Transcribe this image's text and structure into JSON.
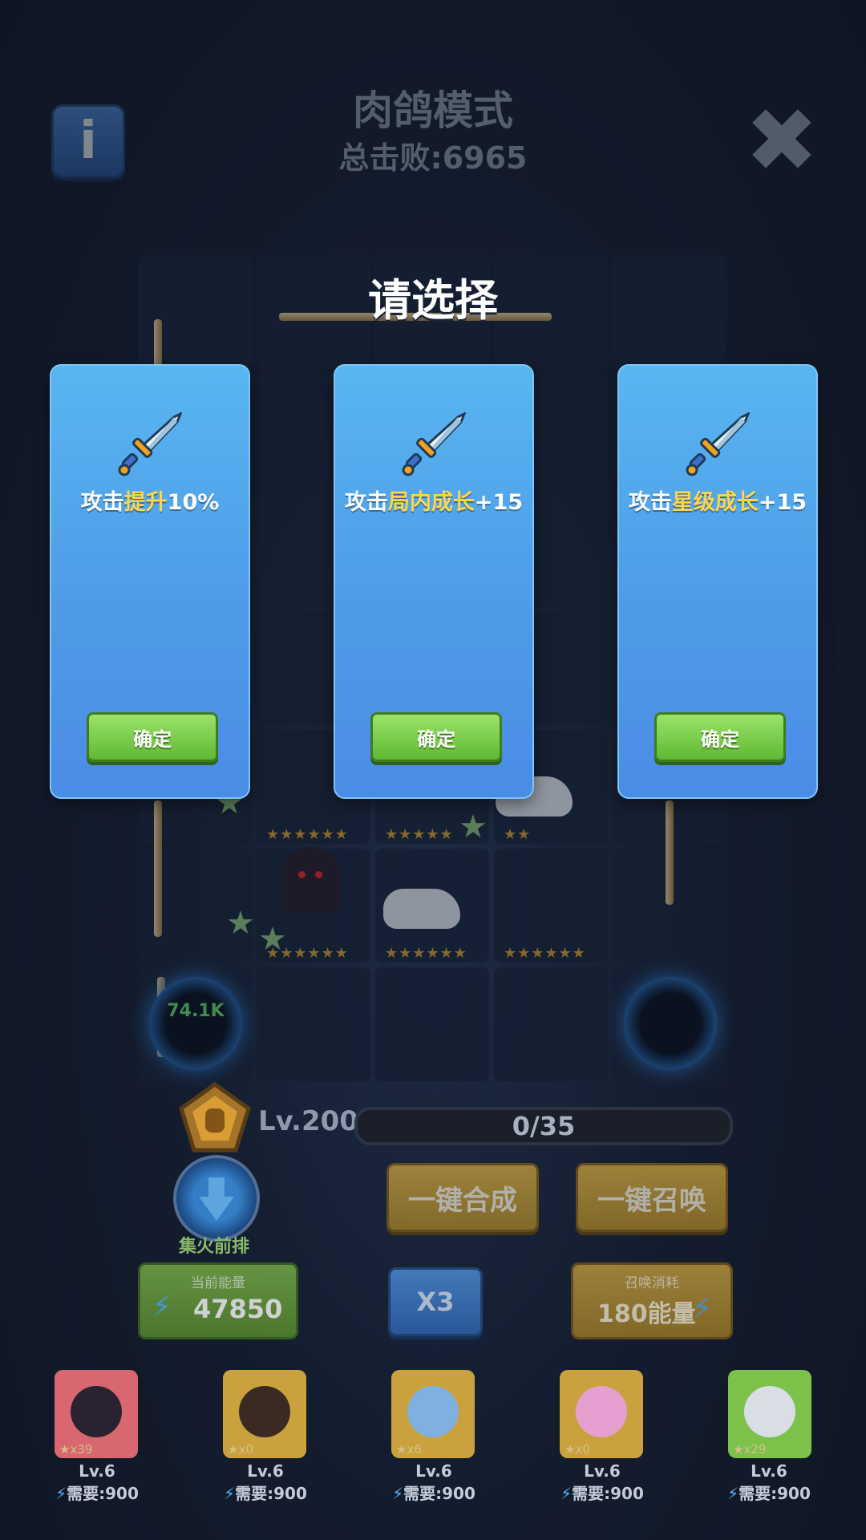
{
  "header": {
    "title": "肉鸽模式",
    "subtitle": "总击败:6965"
  },
  "overlay": {
    "prompt": "请选择",
    "cards": [
      {
        "prefix": "攻击",
        "highlight": "提升",
        "suffix": "10%",
        "button": "确定"
      },
      {
        "prefix": "攻击",
        "highlight": "局内成长",
        "suffix": "+15",
        "button": "确定"
      },
      {
        "prefix": "攻击",
        "highlight": "星级成长",
        "suffix": "+15",
        "button": "确定"
      }
    ]
  },
  "board": {
    "left_portal_text": "74.1K"
  },
  "progress": {
    "level": "Lv.200",
    "xp": "0/35"
  },
  "actions": {
    "merge": "一键合成",
    "summon": "一键召唤",
    "focus_label": "集火前排",
    "multiplier": "X3"
  },
  "energy": {
    "caption": "当前能量",
    "value": "47850"
  },
  "summon_cost": {
    "caption": "召唤消耗",
    "value": "180能量"
  },
  "roster": [
    {
      "count": "x39",
      "level": "Lv.6",
      "need": "需要:900",
      "color": "#e06a72"
    },
    {
      "count": "x0",
      "level": "Lv.6",
      "need": "需要:900",
      "color": "#caa43e"
    },
    {
      "count": "x6",
      "level": "Lv.6",
      "need": "需要:900",
      "color": "#caa43e"
    },
    {
      "count": "x0",
      "level": "Lv.6",
      "need": "需要:900",
      "color": "#caa43e"
    },
    {
      "count": "x29",
      "level": "Lv.6",
      "need": "需要:900",
      "color": "#7cc24a"
    }
  ],
  "colors": {
    "card_blue": "#4f9be8",
    "confirm_green": "#5fb833",
    "highlight_yellow": "#ffd54a"
  },
  "icons": [
    "info-icon",
    "close-icon",
    "sword-icon",
    "lightning-bolt-icon",
    "star-icon",
    "rank-badge-icon",
    "focus-fire-icon"
  ]
}
